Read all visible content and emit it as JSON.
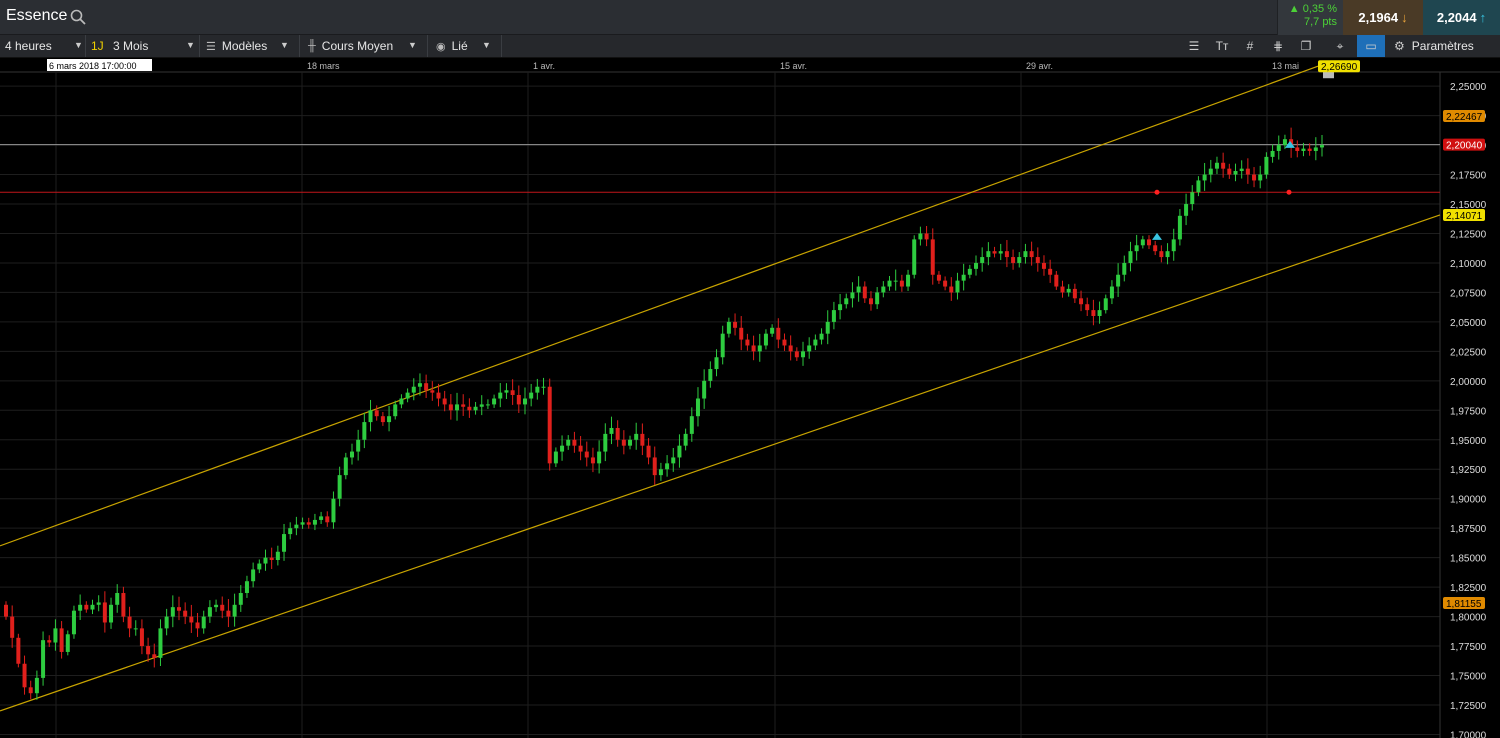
{
  "header": {
    "title": "Essence",
    "change_pct": "▲ 0,35 %",
    "change_pts": "7,7 pts",
    "sell": "2,1964",
    "buy": "2,2044"
  },
  "toolbar": {
    "interval": "4 heures",
    "quick": "1J",
    "range": "3 Mois",
    "models": "Modèles",
    "price_type": "Cours Moyen",
    "link": "Lié",
    "settings": "Paramètres"
  },
  "colors": {
    "up": "#2ecc40",
    "down": "#e0201c",
    "channel": "#c8a400",
    "accent": "#1e6fb8"
  },
  "chart_data": {
    "type": "candlestick",
    "crosshair_date": "6 mars 2018 17:00:00",
    "x_ticks": [
      "18 mars",
      "1 avr.",
      "15 avr.",
      "29 avr.",
      "13 mai"
    ],
    "y_ticks": [
      "2,25000",
      "2,22500",
      "2,20000",
      "2,17500",
      "2,15000",
      "2,12500",
      "2,10000",
      "2,07500",
      "2,05000",
      "2,02500",
      "2,00000",
      "1,97500",
      "1,95000",
      "1,92500",
      "1,90000",
      "1,87500",
      "1,85000",
      "1,82500",
      "1,80000",
      "1,77500",
      "1,75000",
      "1,72500",
      "1,70000"
    ],
    "ylim": [
      1.697,
      2.262
    ],
    "price_labels": [
      {
        "value": 2.2669,
        "text": "2,26690",
        "style": "yellow"
      },
      {
        "value": 2.22467,
        "text": "2,22467",
        "style": "orange"
      },
      {
        "value": 2.2004,
        "text": "2,20040",
        "style": "red"
      },
      {
        "value": 2.14071,
        "text": "2,14071",
        "style": "yellow"
      },
      {
        "value": 1.81155,
        "text": "1,81155",
        "style": "orange"
      }
    ],
    "horizontal_lines": [
      {
        "value": 2.2004,
        "color": "#9a9a9a"
      },
      {
        "value": 2.16,
        "color": "#c0161a"
      }
    ],
    "channel_lines": [
      {
        "start": [
          0,
          1.86
        ],
        "end": [
          1318,
          2.2669
        ]
      },
      {
        "start": [
          0,
          1.72
        ],
        "end": [
          1440,
          2.14071
        ]
      }
    ],
    "closes": [
      1.8,
      1.782,
      1.76,
      1.74,
      1.735,
      1.748,
      1.78,
      1.778,
      1.79,
      1.77,
      1.785,
      1.805,
      1.81,
      1.806,
      1.81,
      1.812,
      1.795,
      1.81,
      1.82,
      1.8,
      1.79,
      1.79,
      1.775,
      1.768,
      1.765,
      1.79,
      1.8,
      1.808,
      1.805,
      1.8,
      1.795,
      1.79,
      1.8,
      1.808,
      1.81,
      1.805,
      1.8,
      1.81,
      1.82,
      1.83,
      1.84,
      1.845,
      1.85,
      1.848,
      1.855,
      1.87,
      1.875,
      1.878,
      1.88,
      1.878,
      1.882,
      1.885,
      1.88,
      1.9,
      1.92,
      1.935,
      1.94,
      1.95,
      1.965,
      1.975,
      1.97,
      1.965,
      1.97,
      1.98,
      1.985,
      1.99,
      1.995,
      1.998,
      1.992,
      1.99,
      1.985,
      1.98,
      1.975,
      1.98,
      1.978,
      1.975,
      1.978,
      1.98,
      1.98,
      1.985,
      1.99,
      1.992,
      1.988,
      1.98,
      1.985,
      1.99,
      1.995,
      1.995,
      1.93,
      1.94,
      1.945,
      1.95,
      1.945,
      1.94,
      1.935,
      1.93,
      1.94,
      1.955,
      1.96,
      1.95,
      1.945,
      1.95,
      1.955,
      1.945,
      1.935,
      1.92,
      1.925,
      1.93,
      1.935,
      1.945,
      1.955,
      1.97,
      1.985,
      2.0,
      2.01,
      2.02,
      2.04,
      2.05,
      2.045,
      2.035,
      2.03,
      2.025,
      2.03,
      2.04,
      2.045,
      2.035,
      2.03,
      2.025,
      2.02,
      2.025,
      2.03,
      2.035,
      2.04,
      2.05,
      2.06,
      2.065,
      2.07,
      2.075,
      2.08,
      2.07,
      2.065,
      2.075,
      2.08,
      2.085,
      2.085,
      2.08,
      2.09,
      2.12,
      2.125,
      2.12,
      2.09,
      2.085,
      2.08,
      2.075,
      2.085,
      2.09,
      2.095,
      2.1,
      2.105,
      2.11,
      2.108,
      2.11,
      2.105,
      2.1,
      2.105,
      2.11,
      2.105,
      2.1,
      2.095,
      2.09,
      2.08,
      2.075,
      2.078,
      2.07,
      2.065,
      2.06,
      2.055,
      2.06,
      2.07,
      2.08,
      2.09,
      2.1,
      2.11,
      2.115,
      2.12,
      2.115,
      2.11,
      2.105,
      2.11,
      2.12,
      2.14,
      2.15,
      2.16,
      2.17,
      2.175,
      2.18,
      2.185,
      2.18,
      2.175,
      2.178,
      2.18,
      2.175,
      2.17,
      2.175,
      2.19,
      2.195,
      2.2,
      2.205,
      2.198,
      2.195,
      2.197,
      2.195,
      2.198,
      2.2
    ]
  }
}
